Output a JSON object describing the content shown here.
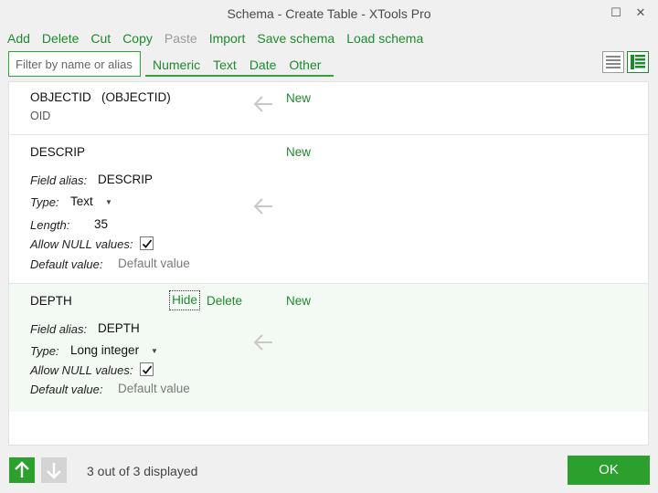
{
  "window": {
    "title": "Schema - Create Table - XTools Pro",
    "maximize_glyph": "☐",
    "close_glyph": "✕"
  },
  "menu": {
    "add": "Add",
    "delete": "Delete",
    "cut": "Cut",
    "copy": "Copy",
    "paste": "Paste",
    "import": "Import",
    "save_schema": "Save schema",
    "load_schema": "Load schema"
  },
  "filter": {
    "placeholder": "Filter by name or alias",
    "value": ""
  },
  "type_tabs": [
    "Numeric",
    "Text",
    "Date",
    "Other"
  ],
  "view_toggles": {
    "list_icon": "list-view-icon",
    "grid_icon": "grid-view-icon",
    "active": "grid"
  },
  "fields": [
    {
      "name": "OBJECTID",
      "alias_paren": "(OBJECTID)",
      "type_sub": "OID",
      "new_label": "New"
    },
    {
      "name": "DESCRIP",
      "new_label": "New",
      "alias_label": "Field alias:",
      "alias_value": "DESCRIP",
      "type_label": "Type:",
      "type_value": "Text",
      "length_label": "Length:",
      "length_value": "35",
      "null_label": "Allow NULL values:",
      "null_checked": true,
      "default_label": "Default value:",
      "default_placeholder": "Default value"
    },
    {
      "name": "DEPTH",
      "hide_label": "Hide",
      "delete_label": "Delete",
      "new_label": "New",
      "alias_label": "Field alias:",
      "alias_value": "DEPTH",
      "type_label": "Type:",
      "type_value": "Long integer",
      "null_label": "Allow NULL values:",
      "null_checked": true,
      "default_label": "Default value:",
      "default_placeholder": "Default value"
    }
  ],
  "footer": {
    "status": "3 out of 3 displayed",
    "ok_label": "OK",
    "move_up_icon": "arrow-up-icon",
    "move_down_icon": "arrow-down-icon"
  },
  "colors": {
    "accent": "#2ca02c",
    "link": "#1e8a2e",
    "disabled": "#9b9b9b",
    "selected_row": "#f3faf3"
  }
}
